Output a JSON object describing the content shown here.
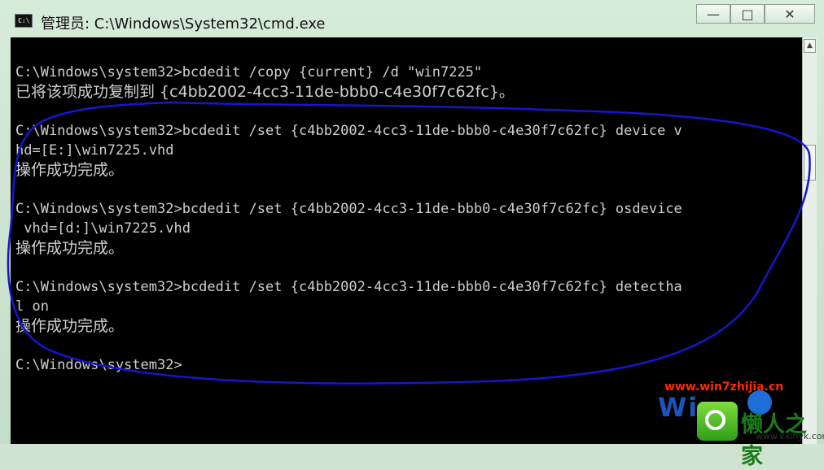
{
  "window": {
    "title": "管理员: C:\\Windows\\System32\\cmd.exe",
    "icon_label": "C:\\",
    "controls": [
      "minimize-icon",
      "restore-icon",
      "close-icon"
    ],
    "control_glyphs": {
      "minimize": "—",
      "restore": "□",
      "close": "✕"
    }
  },
  "console": {
    "lines": [
      "C:\\Windows\\system32>bcdedit /copy {current} /d \"win7225\"",
      "已将该项成功复制到 {c4bb2002-4cc3-11de-bbb0-c4e30f7c62fc}。",
      "C:\\Windows\\system32>bcdedit /set {c4bb2002-4cc3-11de-bbb0-c4e30f7c62fc} device v",
      "hd=[E:]\\win7225.vhd",
      "操作成功完成。",
      "C:\\Windows\\system32>bcdedit /set {c4bb2002-4cc3-11de-bbb0-c4e30f7c62fc} osdevice",
      " vhd=[d:]\\win7225.vhd",
      "操作成功完成。",
      "C:\\Windows\\system32>bcdedit /set {c4bb2002-4cc3-11de-bbb0-c4e30f7c62fc} detectha",
      "l on",
      "操作成功完成。",
      "C:\\Windows\\system32>"
    ]
  },
  "watermark": {
    "url": "www.win7zhijia.cn",
    "brand": "Win",
    "site_name": "懒人之家",
    "site_url": "www.kxinyk.com"
  },
  "colors": {
    "console_bg": "#000000",
    "console_text": "#cfcfcf",
    "annotation": "#1616d0",
    "window_frame": "#cfe3d0"
  }
}
